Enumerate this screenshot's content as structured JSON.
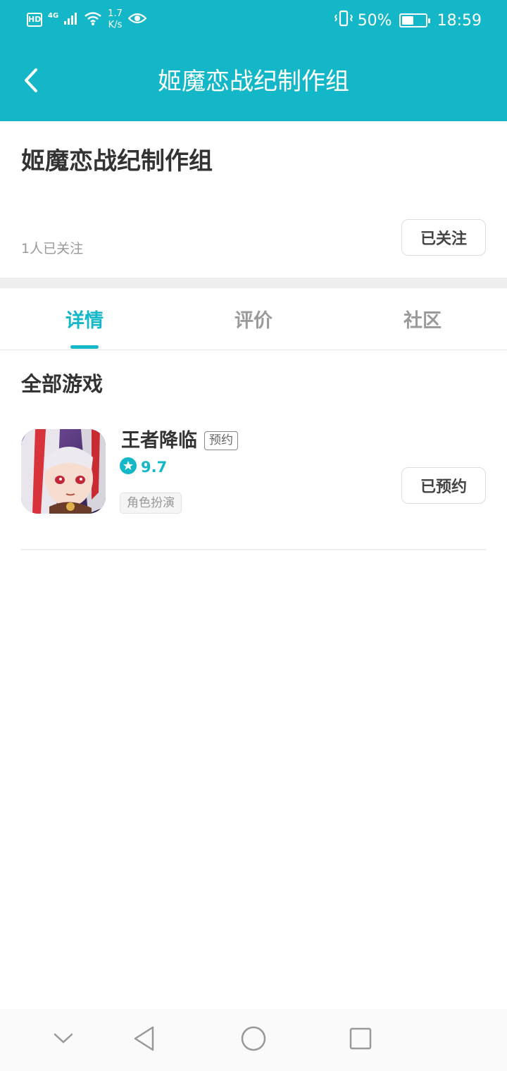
{
  "status_bar": {
    "hd": "HD",
    "signal": "4G",
    "net_speed_value": "1.7",
    "net_speed_unit": "K/s",
    "battery_percent": "50%",
    "battery_level": 0.5,
    "time": "18:59"
  },
  "app_bar": {
    "title": "姬魔恋战纪制作组",
    "back_icon": "chevron-left-icon"
  },
  "header": {
    "studio_name": "姬魔恋战纪制作组",
    "followers_text": "1人已关注",
    "follow_button_label": "已关注"
  },
  "tabs": [
    {
      "label": "详情",
      "active": true
    },
    {
      "label": "评价",
      "active": false
    },
    {
      "label": "社区",
      "active": false
    }
  ],
  "games_section": {
    "title": "全部游戏",
    "games": [
      {
        "name": "王者降临",
        "status_tag": "预约",
        "rating": "9.7",
        "genre": "角色扮演",
        "action_label": "已预约"
      }
    ]
  },
  "nav_bar": {
    "icons": [
      "chevron-down-icon",
      "back-triangle-icon",
      "home-circle-icon",
      "recents-square-icon"
    ]
  },
  "colors": {
    "accent": "#13b7c7",
    "text_primary": "#333333",
    "text_secondary": "#999999"
  }
}
